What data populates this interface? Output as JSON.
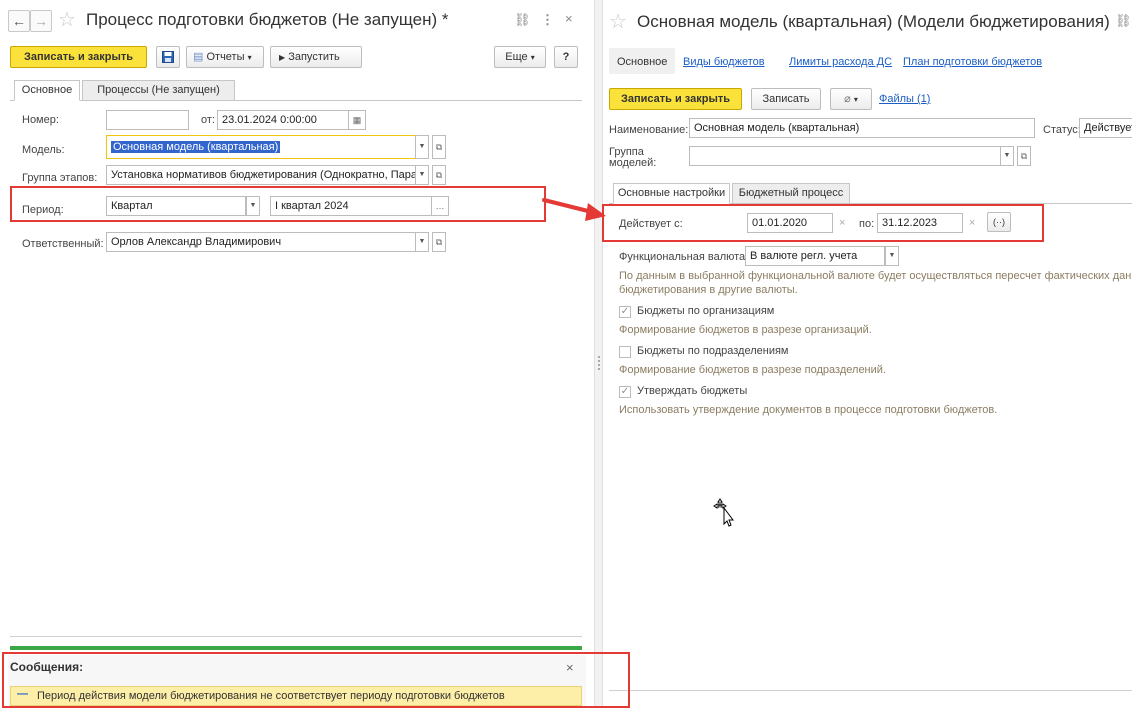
{
  "left": {
    "title": "Процесс подготовки бюджетов (Не запущен) *",
    "nav": {
      "back": "←",
      "forward": "→"
    },
    "toolbar": {
      "save_close": "Записать и закрыть",
      "reports": "Отчеты",
      "run": "Запустить",
      "more": "Еще",
      "help": "?"
    },
    "tabs": [
      "Основное",
      "Процессы (Не запущен)"
    ],
    "fields": {
      "number_label": "Номер:",
      "number_value": "",
      "date_label": "от:",
      "date_value": "23.01.2024  0:00:00",
      "model_label": "Модель:",
      "model_value": "Основная модель (квартальная)",
      "stage_group_label": "Группа этапов:",
      "stage_group_value": "Установка нормативов бюджетирования (Однократно, Парал",
      "period_label": "Период:",
      "period_type": "Квартал",
      "period_value": "I квартал 2024",
      "responsible_label": "Ответственный:",
      "responsible_value": "Орлов Александр Владимирович"
    },
    "messages": {
      "title": "Сообщения:",
      "close": "×",
      "items": [
        "Период действия модели бюджетирования не соответствует периоду подготовки бюджетов"
      ]
    }
  },
  "right": {
    "title": "Основная модель (квартальная) (Модели бюджетирования)",
    "nav_tabs": {
      "main": "Основное",
      "links": [
        "Виды бюджетов",
        "Лимиты расхода ДС",
        "План подготовки бюджетов"
      ]
    },
    "toolbar": {
      "save_close": "Записать и закрыть",
      "save": "Записать",
      "files": "Файлы (1)"
    },
    "fields": {
      "name_label": "Наименование:",
      "name_value": "Основная модель (квартальная)",
      "status_label": "Статус:",
      "status_value": "Действует",
      "group_label_1": "Группа",
      "group_label_2": "моделей:",
      "group_value": ""
    },
    "inner_tabs": [
      "Основные настройки",
      "Бюджетный процесс"
    ],
    "settings": {
      "valid_from_label": "Действует с:",
      "valid_from": "01.01.2020",
      "valid_to_label": "по:",
      "valid_to": "31.12.2023",
      "currency_label": "Функциональная валюта:",
      "currency_value": "В валюте регл. учета",
      "currency_hint_1": "По данным в выбранной функциональной валюте будет осуществляться пересчет фактических данных",
      "currency_hint_2": "бюджетирования в другие валюты.",
      "by_org_label": "Бюджеты по организациям",
      "by_org_checked": true,
      "by_org_hint": "Формирование бюджетов в разрезе организаций.",
      "by_dept_label": "Бюджеты по подразделениям",
      "by_dept_checked": false,
      "by_dept_hint": "Формирование бюджетов в разрезе подразделений.",
      "approve_label": "Утверждать бюджеты",
      "approve_checked": true,
      "approve_hint": "Использовать утверждение документов в процессе подготовки бюджетов."
    }
  },
  "colors": {
    "primary_button": "#fbe23b",
    "highlight_box": "#e53935",
    "arrow": "#e53935",
    "message_bar": "#fdeea8",
    "progress_line": "#3aa845",
    "link": "#1b5ec4",
    "hint_text": "#8b7d62"
  }
}
